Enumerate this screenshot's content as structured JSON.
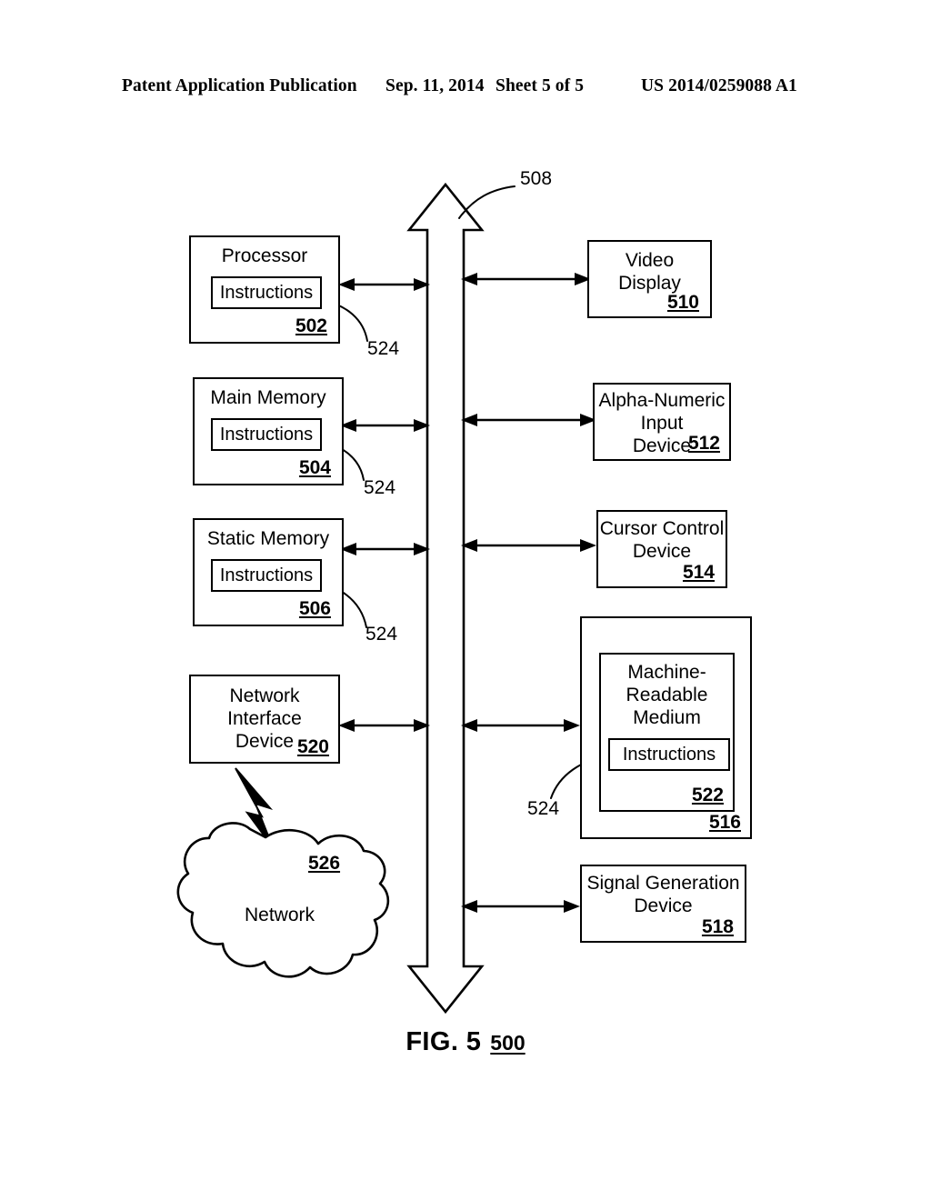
{
  "header": {
    "publication": "Patent Application Publication",
    "date": "Sep. 11, 2014",
    "sheet": "Sheet 5 of 5",
    "patent_number": "US 2014/0259088 A1"
  },
  "figure": {
    "caption_label": "FIG. 5",
    "caption_number": "500",
    "bus": {
      "ref": "508"
    },
    "left_column": [
      {
        "id": "processor",
        "title": "Processor",
        "ref": "502",
        "inner": {
          "label": "Instructions",
          "leader_ref": "524"
        }
      },
      {
        "id": "main-memory",
        "title": "Main Memory",
        "ref": "504",
        "inner": {
          "label": "Instructions",
          "leader_ref": "524"
        }
      },
      {
        "id": "static-memory",
        "title": "Static Memory",
        "ref": "506",
        "inner": {
          "label": "Instructions",
          "leader_ref": "524"
        }
      },
      {
        "id": "network-interface-device",
        "title": "Network\nInterface\nDevice",
        "ref": "520"
      }
    ],
    "right_column": [
      {
        "id": "video-display",
        "title": "Video\nDisplay",
        "ref": "510"
      },
      {
        "id": "alpha-numeric-input-device",
        "title": "Alpha-Numeric\nInput\nDevice",
        "ref": "512"
      },
      {
        "id": "cursor-control-device",
        "title": "Cursor Control\nDevice",
        "ref": "514"
      },
      {
        "id": "drive-unit",
        "ref": "516",
        "inner_medium": {
          "id": "machine-readable-medium",
          "title": "Machine-\nReadable\nMedium",
          "ref": "522",
          "inner": {
            "label": "Instructions",
            "leader_ref": "524"
          }
        }
      },
      {
        "id": "signal-generation-device",
        "title": "Signal Generation\nDevice",
        "ref": "518"
      }
    ],
    "network": {
      "label": "Network",
      "ref": "526"
    }
  },
  "colors": {
    "ink": "#000000",
    "paper": "#ffffff"
  }
}
